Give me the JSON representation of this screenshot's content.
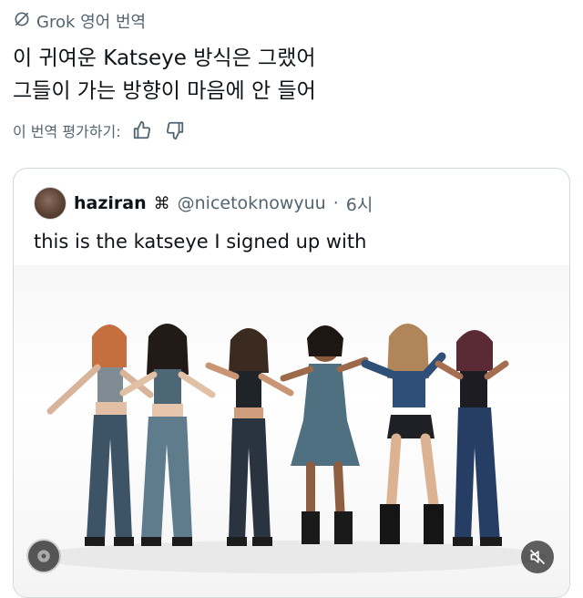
{
  "translation_header": {
    "label": "Grok 영어 번역",
    "icon": "grok-logo-icon"
  },
  "translated_text": {
    "line1": "이 귀여운 Katseye 방식은 그랬어",
    "line2": "그들이 가는 방향이 마음에 안 들어"
  },
  "rate_translation": {
    "label": "이 번역 평가하기:",
    "like_icon": "thumbs-up-icon",
    "dislike_icon": "thumbs-down-icon"
  },
  "quoted_post": {
    "display_name": "haziran",
    "badge": "⌘",
    "handle": "@nicetoknowyuu",
    "separator": "·",
    "time": "6시",
    "text": "this is the katseye I signed up with",
    "media": {
      "type": "video",
      "description_icon": "video-thumbnail",
      "mute_icon": "muted-speaker-icon"
    }
  },
  "colors": {
    "text": "#0f1419",
    "secondary": "#536471",
    "border": "#cfd9de"
  }
}
